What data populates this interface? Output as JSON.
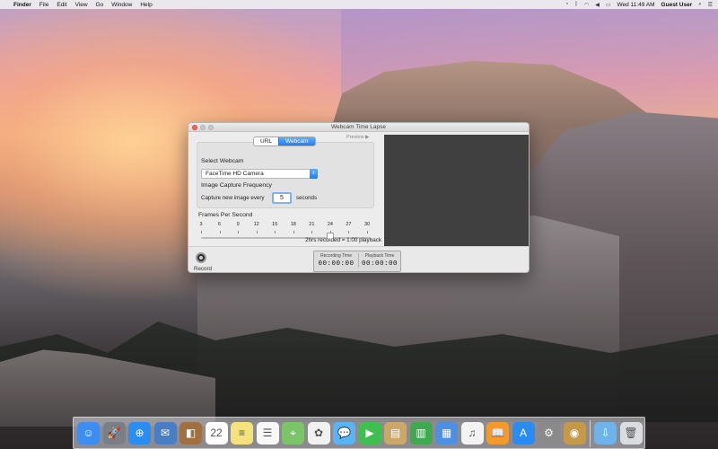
{
  "menubar": {
    "app": "Finder",
    "items": [
      "File",
      "Edit",
      "View",
      "Go",
      "Window",
      "Help"
    ],
    "clock": "Wed 11:49 AM",
    "user": "Guest User"
  },
  "window": {
    "title": "Webcam Time Lapse",
    "tabs": [
      "URL",
      "Webcam"
    ],
    "preview_label": "Preview ▶",
    "select_webcam_label": "Select Webcam",
    "webcam_value": "FaceTime HD Camera",
    "capture_freq_label": "Image Capture Frequency",
    "capture_prefix": "Capture new image every",
    "capture_value": "5",
    "capture_suffix": "seconds",
    "fps_label": "Frames Per Second",
    "fps_ticks": [
      "3",
      "6",
      "9",
      "12",
      "15",
      "18",
      "21",
      "24",
      "27",
      "30"
    ],
    "fps_selected": 24,
    "playback_info": "2hrs recorded = 1:00 playback",
    "record_label": "Record",
    "recording_time_label": "Recording Time",
    "recording_time": "00:00:00",
    "playback_time_label": "Playback Time",
    "playback_time": "00:00:00"
  },
  "dock": {
    "icons": [
      {
        "name": "finder-icon",
        "color": "#3d8ef0",
        "glyph": "☺"
      },
      {
        "name": "launchpad-icon",
        "color": "#7a7f87",
        "glyph": "🚀"
      },
      {
        "name": "safari-icon",
        "color": "#2a8df2",
        "glyph": "⊕"
      },
      {
        "name": "mail-icon",
        "color": "#4a7ec4",
        "glyph": "✉"
      },
      {
        "name": "contacts-icon",
        "color": "#a07040",
        "glyph": "◧"
      },
      {
        "name": "calendar-icon",
        "color": "#ffffff",
        "glyph": "22"
      },
      {
        "name": "notes-icon",
        "color": "#f4e27a",
        "glyph": "≡"
      },
      {
        "name": "reminders-icon",
        "color": "#f8f8f8",
        "glyph": "☰"
      },
      {
        "name": "maps-icon",
        "color": "#7cc46a",
        "glyph": "⌖"
      },
      {
        "name": "photos-icon",
        "color": "#f1f1f1",
        "glyph": "✿"
      },
      {
        "name": "messages-icon",
        "color": "#58b4f5",
        "glyph": "💬"
      },
      {
        "name": "facetime-icon",
        "color": "#3fbf4f",
        "glyph": "▶"
      },
      {
        "name": "preview-icon",
        "color": "#c9a86a",
        "glyph": "▤"
      },
      {
        "name": "numbers-icon",
        "color": "#3fa94f",
        "glyph": "▥"
      },
      {
        "name": "keynote-icon",
        "color": "#4d8fe0",
        "glyph": "▦"
      },
      {
        "name": "itunes-icon",
        "color": "#f3f3f3",
        "glyph": "♫"
      },
      {
        "name": "ibooks-icon",
        "color": "#f29a2a",
        "glyph": "📖"
      },
      {
        "name": "app-store-icon",
        "color": "#2a8bf0",
        "glyph": "A"
      },
      {
        "name": "system-preferences-icon",
        "color": "#8a8a8a",
        "glyph": "⚙"
      },
      {
        "name": "webcam-time-lapse-icon",
        "color": "#c49a4a",
        "glyph": "◉"
      },
      {
        "name": "downloads-folder-icon",
        "color": "#6fb3ea",
        "glyph": "⇩"
      },
      {
        "name": "trash-icon",
        "color": "#d9dde2",
        "glyph": "🗑"
      }
    ]
  }
}
